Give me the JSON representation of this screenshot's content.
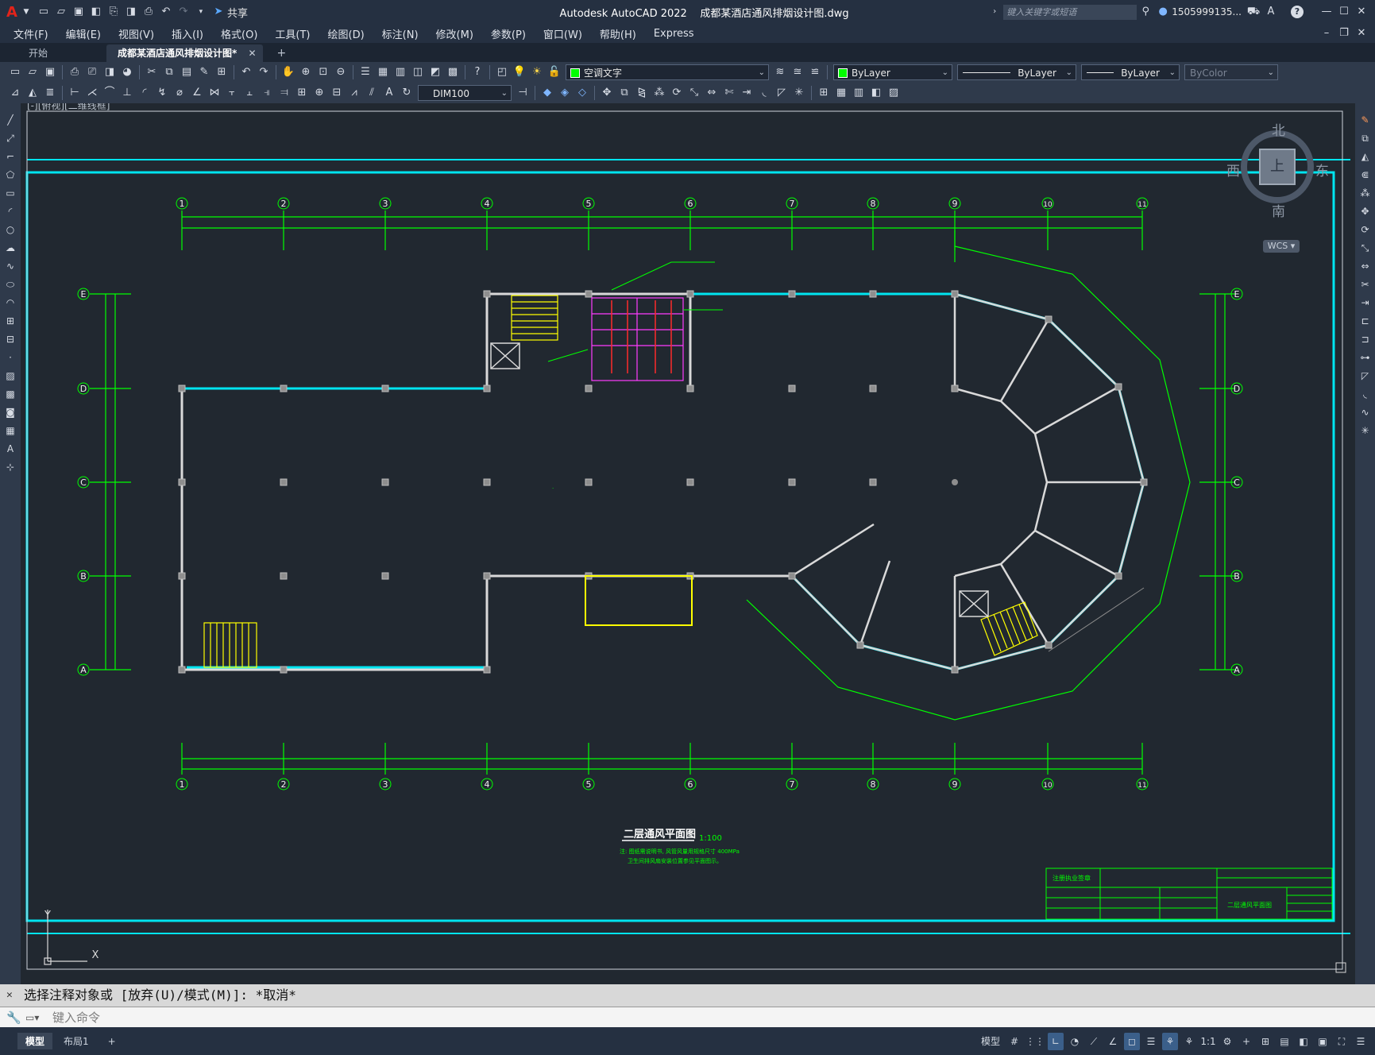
{
  "titlebar": {
    "app_letter": "A",
    "share_label": "共享",
    "title": "Autodesk AutoCAD 2022    成都某酒店通风排烟设计图.dwg",
    "search_placeholder": "键入关键字或短语",
    "user": "1505999135...",
    "help": "?"
  },
  "menu": [
    "文件(F)",
    "编辑(E)",
    "视图(V)",
    "插入(I)",
    "格式(O)",
    "工具(T)",
    "绘图(D)",
    "标注(N)",
    "修改(M)",
    "参数(P)",
    "窗口(W)",
    "帮助(H)",
    "Express"
  ],
  "tabs": {
    "start": "开始",
    "active": "成都某酒店通风排烟设计图*",
    "add": "+"
  },
  "toolbar": {
    "layer": "空调文字",
    "color": "ByLayer",
    "linetype": "ByLayer",
    "lineweight": "ByLayer",
    "plotstyle": "ByColor",
    "dimstyle": "DIM100"
  },
  "viewport": {
    "label": "[-][俯视][二维线框]",
    "compass": {
      "north": "北",
      "south": "南",
      "east": "东",
      "west": "西",
      "top": "上"
    },
    "wcs": "WCS ▾",
    "ucs_y": "Y",
    "ucs_x": "X"
  },
  "drawing": {
    "grid_numbers": [
      "1",
      "2",
      "3",
      "4",
      "5",
      "6",
      "7",
      "8",
      "9",
      "10",
      "11"
    ],
    "grid_letters": [
      "E",
      "D",
      "C",
      "B",
      "A"
    ],
    "plan_title": "二层通风平面图",
    "scale": "1:100",
    "notes_line1": "注: 图纸需说明书, 风管风量用规格尺寸 400MPa",
    "notes_line2": "卫生间排风扇安装位置参见平面图示。",
    "titleblock": {
      "stamp_label": "注册执业签章",
      "drawing_name": "二层通风平面图"
    }
  },
  "command": {
    "history": "选择注释对象或 [放弃(U)/模式(M)]: *取消*",
    "placeholder": "键入命令"
  },
  "status": {
    "layout_tabs": [
      "模型",
      "布局1"
    ],
    "add": "+",
    "model": "模型",
    "scale": "1:1"
  },
  "colors": {
    "accent_cyan": "#00e5f0",
    "grid_green": "#00ff00",
    "wall_white": "#d9d9d9",
    "stair_yellow": "#ffff00",
    "duct_magenta": "#ff3cff"
  }
}
